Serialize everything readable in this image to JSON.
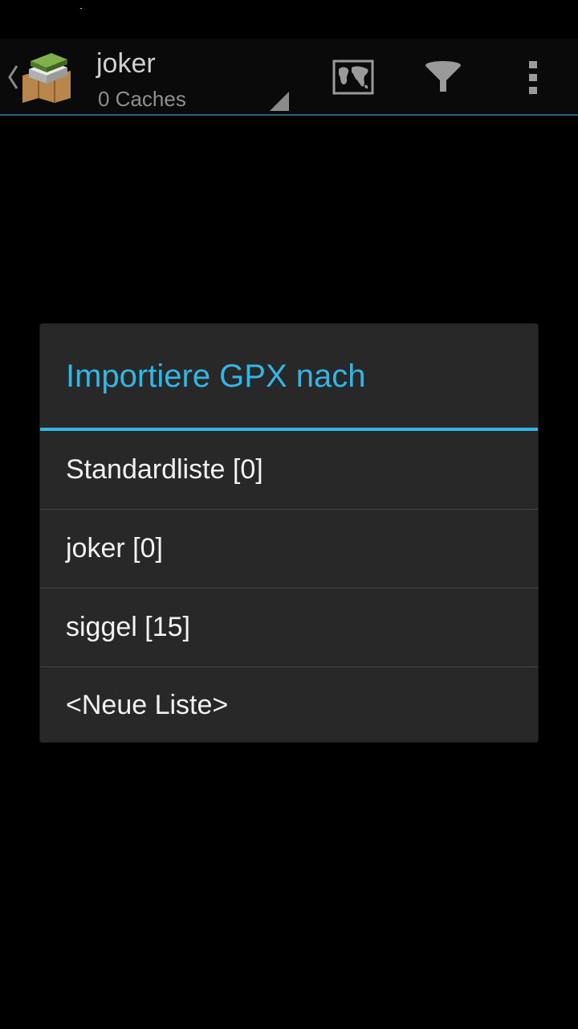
{
  "actionbar": {
    "title": "joker",
    "subtitle": "0 Caches",
    "icons": {
      "up": "chevron-left-icon",
      "app": "geocache-map-icon",
      "map": "map-icon",
      "filter": "filter-icon",
      "overflow": "overflow-menu-icon"
    }
  },
  "dialog": {
    "title": "Importiere GPX nach",
    "items": [
      {
        "label": "Standardliste [0]"
      },
      {
        "label": "joker [0]"
      },
      {
        "label": "siggel [15]"
      },
      {
        "label": "<Neue Liste>"
      }
    ]
  },
  "colors": {
    "accent": "#33b5e5",
    "dialog_bg": "#282828",
    "background": "#000000"
  }
}
